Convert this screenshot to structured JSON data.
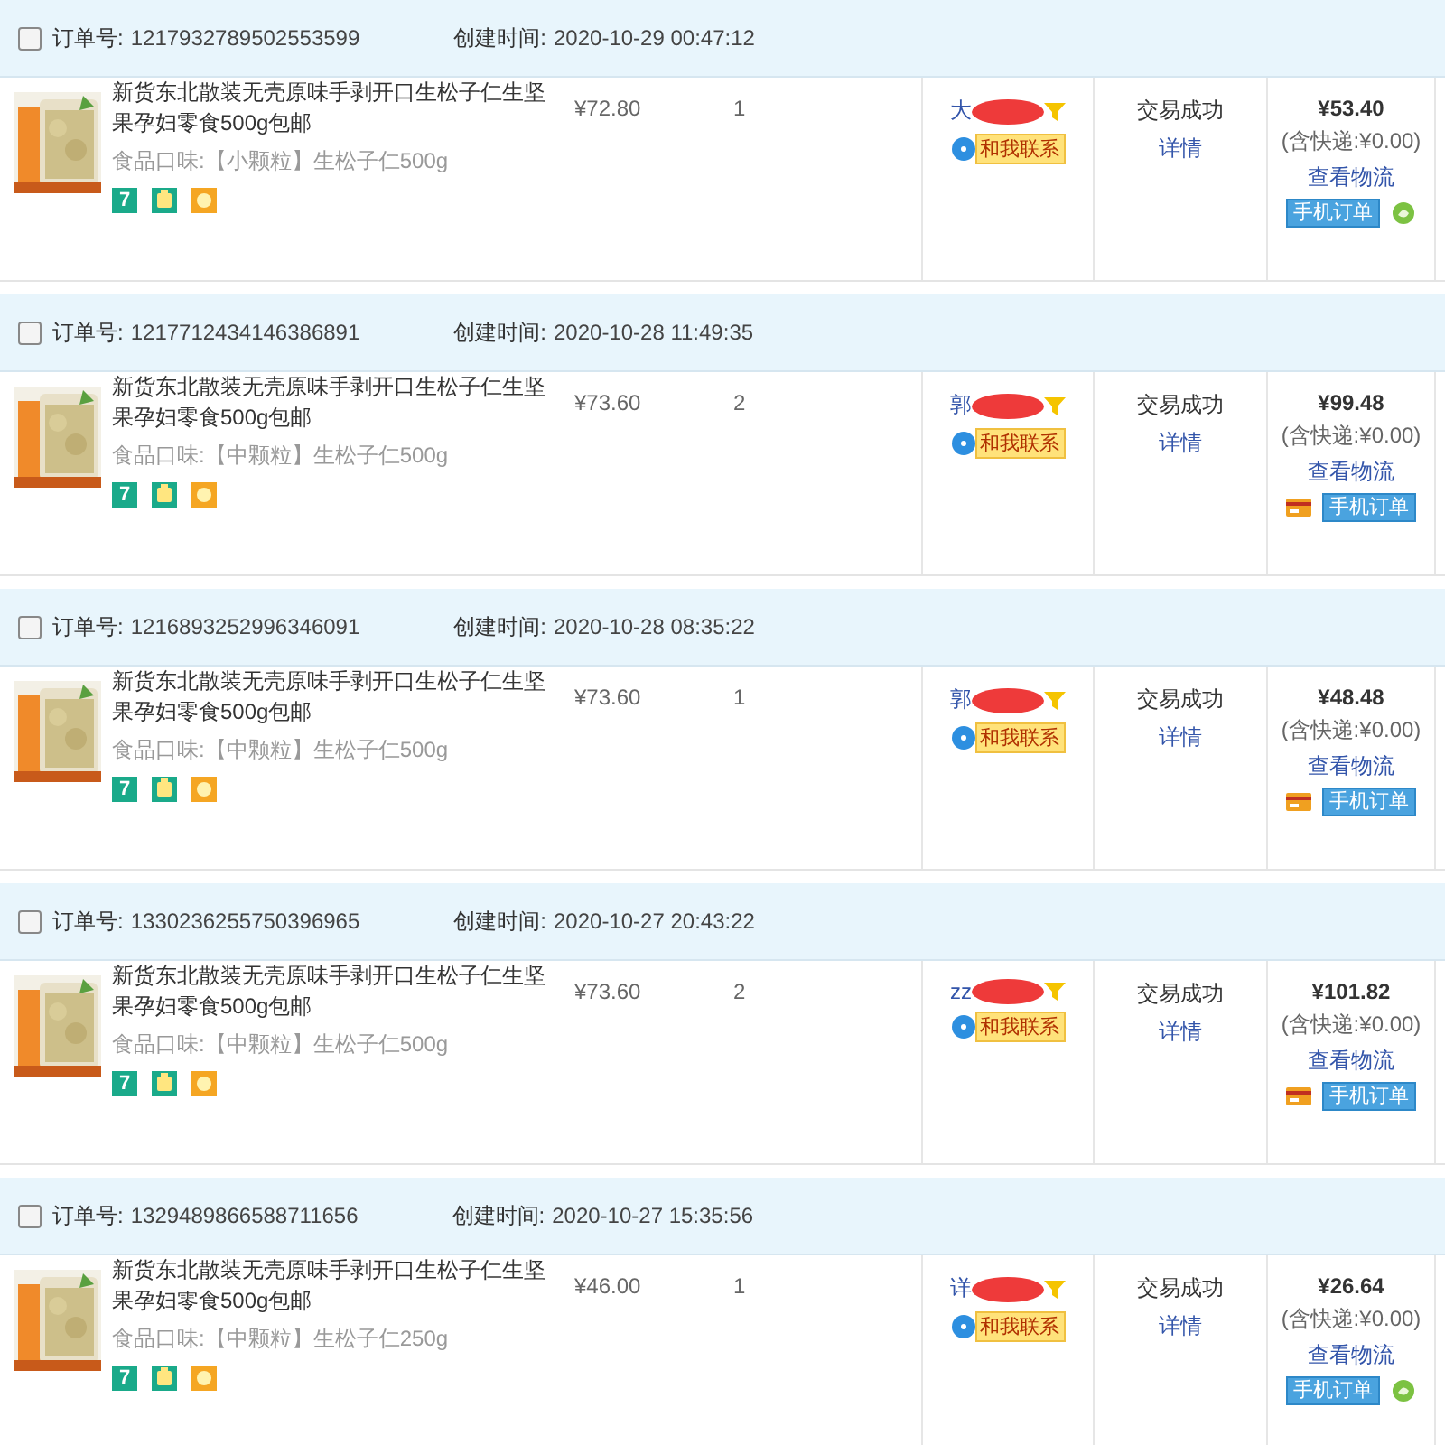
{
  "orders": [
    {
      "checked": false,
      "order_label": "订单号:",
      "order_no": "1217932789502553599",
      "created_label": "创建时间:",
      "created": "2020-10-29 00:47:12",
      "title": "新货东北散装无壳原味手剥开口生松子仁生坚果孕妇零食500g包邮",
      "price": "¥72.80",
      "qty": "1",
      "flavor_label": "食品口味:",
      "spec": "【小颗粒】生松子仁500g",
      "services": [
        {
          "kind": "seven",
          "label": "7"
        },
        {
          "kind": "guarantee"
        },
        {
          "kind": "sun"
        }
      ],
      "buyer": "大",
      "contact": "和我联系",
      "status": "交易成功",
      "detail": "详情",
      "total": "¥53.40",
      "shipping": "(含快递:¥0.00)",
      "logistics": "查看物流",
      "tags": [
        {
          "kind": "mobile",
          "label": "手机订单"
        },
        {
          "kind": "swirl"
        }
      ]
    },
    {
      "checked": false,
      "order_label": "订单号:",
      "order_no": "1217712434146386891",
      "created_label": "创建时间:",
      "created": "2020-10-28 11:49:35",
      "title": "新货东北散装无壳原味手剥开口生松子仁生坚果孕妇零食500g包邮",
      "price": "¥73.60",
      "qty": "2",
      "flavor_label": "食品口味:",
      "spec": "【中颗粒】生松子仁500g",
      "services": [
        {
          "kind": "seven",
          "label": "7"
        },
        {
          "kind": "guarantee"
        },
        {
          "kind": "sun"
        }
      ],
      "buyer": "郭",
      "contact": "和我联系",
      "status": "交易成功",
      "detail": "详情",
      "total": "¥99.48",
      "shipping": "(含快递:¥0.00)",
      "logistics": "查看物流",
      "tags": [
        {
          "kind": "card"
        },
        {
          "kind": "mobile",
          "label": "手机订单"
        }
      ]
    },
    {
      "checked": false,
      "order_label": "订单号:",
      "order_no": "1216893252996346091",
      "created_label": "创建时间:",
      "created": "2020-10-28 08:35:22",
      "title": "新货东北散装无壳原味手剥开口生松子仁生坚果孕妇零食500g包邮",
      "price": "¥73.60",
      "qty": "1",
      "flavor_label": "食品口味:",
      "spec": "【中颗粒】生松子仁500g",
      "services": [
        {
          "kind": "seven",
          "label": "7"
        },
        {
          "kind": "guarantee"
        },
        {
          "kind": "sun"
        }
      ],
      "buyer": "郭",
      "contact": "和我联系",
      "status": "交易成功",
      "detail": "详情",
      "total": "¥48.48",
      "shipping": "(含快递:¥0.00)",
      "logistics": "查看物流",
      "tags": [
        {
          "kind": "card"
        },
        {
          "kind": "mobile",
          "label": "手机订单"
        }
      ]
    },
    {
      "checked": false,
      "order_label": "订单号:",
      "order_no": "1330236255750396965",
      "created_label": "创建时间:",
      "created": "2020-10-27 20:43:22",
      "title": "新货东北散装无壳原味手剥开口生松子仁生坚果孕妇零食500g包邮",
      "price": "¥73.60",
      "qty": "2",
      "flavor_label": "食品口味:",
      "spec": "【中颗粒】生松子仁500g",
      "services": [
        {
          "kind": "seven",
          "label": "7"
        },
        {
          "kind": "guarantee"
        },
        {
          "kind": "sun"
        }
      ],
      "buyer": "zz",
      "contact": "和我联系",
      "status": "交易成功",
      "detail": "详情",
      "total": "¥101.82",
      "shipping": "(含快递:¥0.00)",
      "logistics": "查看物流",
      "tags": [
        {
          "kind": "card"
        },
        {
          "kind": "mobile",
          "label": "手机订单"
        }
      ]
    },
    {
      "checked": false,
      "order_label": "订单号:",
      "order_no": "1329489866588711656",
      "created_label": "创建时间:",
      "created": "2020-10-27 15:35:56",
      "title": "新货东北散装无壳原味手剥开口生松子仁生坚果孕妇零食500g包邮",
      "price": "¥46.00",
      "qty": "1",
      "flavor_label": "食品口味:",
      "spec": "【中颗粒】生松子仁250g",
      "services": [
        {
          "kind": "seven",
          "label": "7"
        },
        {
          "kind": "guarantee"
        },
        {
          "kind": "sun"
        }
      ],
      "buyer": "详",
      "contact": "和我联系",
      "status": "交易成功",
      "detail": "详情",
      "total": "¥26.64",
      "shipping": "(含快递:¥0.00)",
      "logistics": "查看物流",
      "tags": [
        {
          "kind": "mobile",
          "label": "手机订单"
        },
        {
          "kind": "swirl"
        }
      ]
    }
  ]
}
